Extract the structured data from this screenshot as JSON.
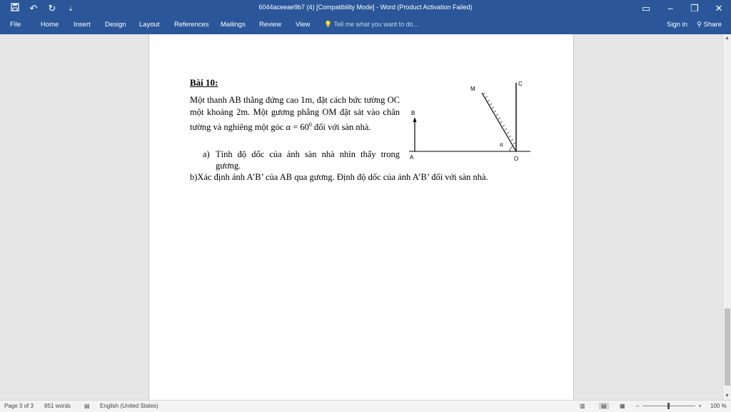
{
  "window": {
    "title": "6044aceeae9b7 (4) [Compatibility Mode] - Word (Product Activation Failed)",
    "qat_icons": [
      "save-icon",
      "undo-icon",
      "redo-icon",
      "customize-icon"
    ]
  },
  "ribbon": {
    "tabs": [
      "File",
      "Home",
      "Insert",
      "Design",
      "Layout",
      "References",
      "Mailings",
      "Review",
      "View"
    ],
    "tell_me": "Tell me what you want to do...",
    "sign_in": "Sign in",
    "share": "Share"
  },
  "document": {
    "heading": "Bài 10:",
    "paragraph_main": "Một thanh AB thẳng đứng cao 1m, đặt cách bức tường OC một khoảng 2m. Một gương phẳng OM đặt sát vào chân tường và nghiêng một góc  α = 60",
    "paragraph_sup": "0",
    "paragraph_end": "đối với sàn nhà.",
    "item_a_marker": "a)",
    "item_a_text": "Tính độ dốc của ảnh sàn nhà nhìn thấy trong gương.",
    "item_b_text": "b)Xác định ảnh A’B’ của AB qua gương. Định độ dốc của ảnh A’B’ đối với sàn nhà.",
    "diagram_labels": {
      "M": "M",
      "C": "C",
      "B": "B",
      "A": "A",
      "O": "O",
      "alpha": "α"
    }
  },
  "status": {
    "page": "Page 3 of 3",
    "words": "851 words",
    "language": "English (United States)",
    "zoom": "100 %"
  }
}
